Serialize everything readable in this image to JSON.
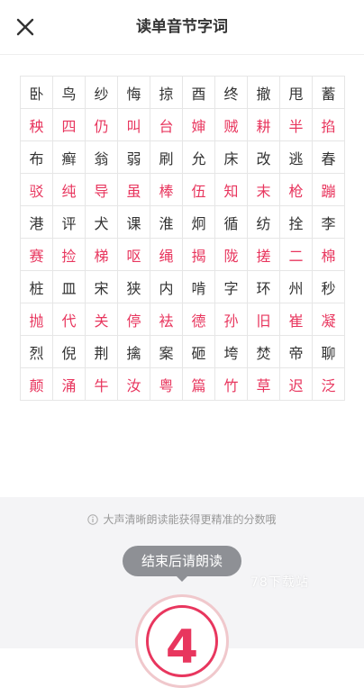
{
  "header": {
    "title": "读单音节字词",
    "close_icon": "close-icon"
  },
  "grid": {
    "colors": {
      "black": "#333333",
      "red": "#e8365e"
    },
    "rows": [
      {
        "color": "black",
        "chars": [
          "卧",
          "鸟",
          "纱",
          "悔",
          "掠",
          "酉",
          "终",
          "撤",
          "甩",
          "蓄"
        ]
      },
      {
        "color": "red",
        "chars": [
          "秧",
          "四",
          "仍",
          "叫",
          "台",
          "婶",
          "贼",
          "耕",
          "半",
          "掐"
        ]
      },
      {
        "color": "black",
        "chars": [
          "布",
          "癣",
          "翁",
          "弱",
          "刷",
          "允",
          "床",
          "改",
          "逃",
          "春"
        ]
      },
      {
        "color": "red",
        "chars": [
          "驳",
          "纯",
          "导",
          "虽",
          "棒",
          "伍",
          "知",
          "末",
          "枪",
          "蹦"
        ]
      },
      {
        "color": "black",
        "chars": [
          "港",
          "评",
          "犬",
          "课",
          "淮",
          "炯",
          "循",
          "纺",
          "拴",
          "李"
        ]
      },
      {
        "color": "red",
        "chars": [
          "赛",
          "捡",
          "梯",
          "呕",
          "绳",
          "揭",
          "陇",
          "搓",
          "二",
          "棉"
        ]
      },
      {
        "color": "black",
        "chars": [
          "桩",
          "皿",
          "宋",
          "狭",
          "内",
          "啃",
          "字",
          "环",
          "州",
          "秒"
        ]
      },
      {
        "color": "red",
        "chars": [
          "抛",
          "代",
          "关",
          "停",
          "袪",
          "德",
          "孙",
          "旧",
          "崔",
          "凝"
        ]
      },
      {
        "color": "black",
        "chars": [
          "烈",
          "倪",
          "荆",
          "擒",
          "案",
          "砸",
          "垮",
          "焚",
          "帝",
          "聊"
        ]
      },
      {
        "color": "red",
        "chars": [
          "颠",
          "涌",
          "牛",
          "汝",
          "粤",
          "篇",
          "竹",
          "草",
          "迟",
          "泛"
        ]
      }
    ]
  },
  "bottom": {
    "tip_icon": "info-icon",
    "tip": "大声清晰朗读能获得更精准的分数哦",
    "tooltip": "结束后请朗读",
    "watermark": "78下载站",
    "countdown": "4"
  }
}
